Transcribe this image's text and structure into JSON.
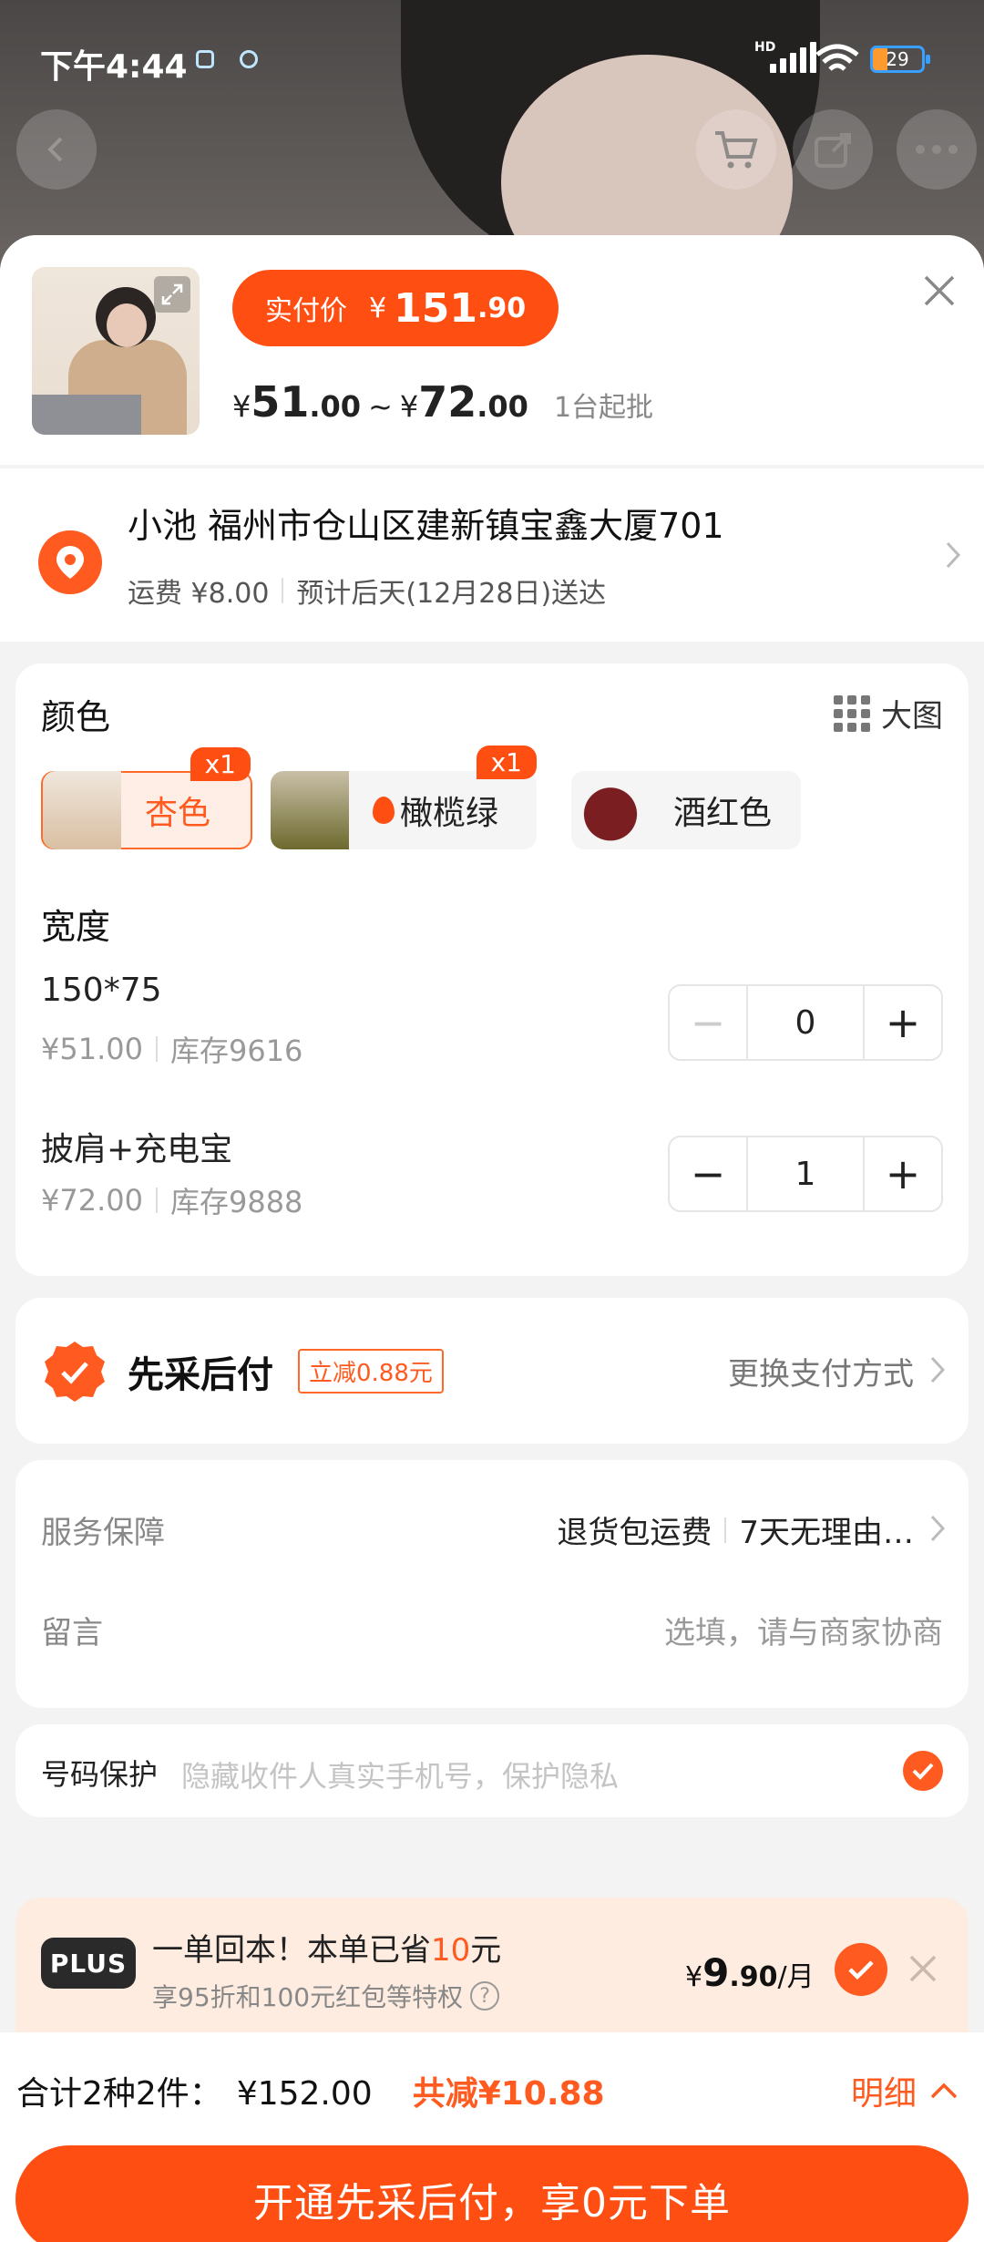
{
  "status_bar": {
    "time": "下午4:44",
    "network": "HD",
    "battery": "29"
  },
  "product": {
    "pay_label": "实付价",
    "pay_currency": "¥",
    "pay_int": "151",
    "pay_dec": ".90",
    "range_currency": "¥",
    "range_low_int": "51",
    "range_low_dec": ".00",
    "range_sep": "~",
    "range_high_int": "72",
    "range_high_dec": ".00",
    "min_order": "1台起批"
  },
  "address": {
    "name_line": "小池 福州市仓山区建新镇宝鑫大厦701",
    "shipping": "运费 ¥8.00",
    "delivery": "预计后天(12月28日)送达"
  },
  "color_section": {
    "title": "颜色",
    "big_image": "大图",
    "options": [
      {
        "label": "杏色",
        "badge": "x1",
        "selected": true
      },
      {
        "label": "橄榄绿",
        "badge": "x1",
        "selected": false
      },
      {
        "label": "酒红色",
        "badge": "",
        "selected": false
      }
    ]
  },
  "width_section": {
    "title": "宽度",
    "rows": [
      {
        "name": "150*75",
        "price": "¥51.00",
        "stock": "库存9616",
        "qty": "0",
        "minus": "−",
        "plus": "+"
      },
      {
        "name": "披肩+充电宝",
        "price": "¥72.00",
        "stock": "库存9888",
        "qty": "1",
        "minus": "−",
        "plus": "+"
      }
    ]
  },
  "payment": {
    "title": "先采后付",
    "discount": "立减0.88元",
    "change": "更换支付方式"
  },
  "service": {
    "label": "服务保障",
    "item1": "退货包运费",
    "item2": "7天无理由…",
    "note_label": "留言",
    "note_placeholder": "选填，请与商家协商"
  },
  "phone": {
    "label": "号码保护",
    "placeholder": "隐藏收件人真实手机号，保护隐私"
  },
  "plus": {
    "badge": "PLUS",
    "line1_a": "一单回本！本单已省",
    "line1_b": "10",
    "line1_c": "元",
    "line2": "享95折和100元红包等特权",
    "help": "?",
    "price_cur": "¥",
    "price_int": "9",
    "price_dec": ".90",
    "price_unit": "/月"
  },
  "summary": {
    "count": "合计2种2件：",
    "amount": "¥152.00",
    "saved": "共减¥10.88",
    "detail": "明细"
  },
  "cta": {
    "label": "开通先采后付，享0元下单"
  },
  "colors": {
    "accent": "#ff4e12",
    "accent_light": "#ffeee6",
    "background": "#f3f3f3"
  }
}
